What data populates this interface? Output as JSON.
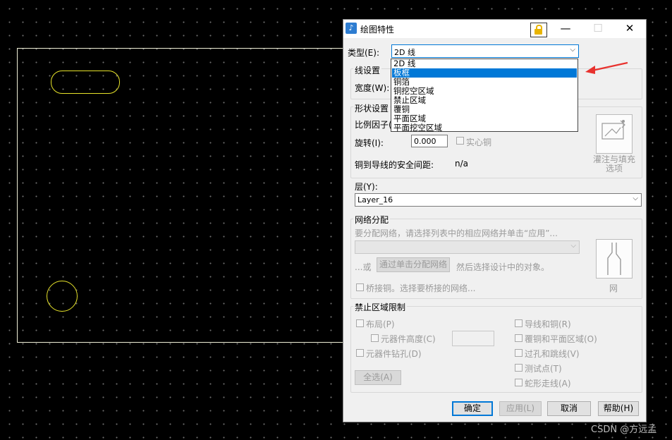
{
  "dialog": {
    "title": "绘图特性",
    "close_glyph": "✕",
    "minimize_glyph": "—",
    "maximize_glyph": "☐"
  },
  "type": {
    "label": "类型(E):",
    "value": "2D 线",
    "options": [
      "2D 线",
      "板框",
      "铜箔",
      "铜挖空区域",
      "禁止区域",
      "覆铜",
      "平面区域",
      "平面挖空区域"
    ],
    "selected_highlight": "板框"
  },
  "line_settings": {
    "group_label": "线设置",
    "width_label": "宽度(W):"
  },
  "shape_settings": {
    "group_label": "形状设置",
    "scale_label": "比例因子(",
    "rotate_label": "旋转(I):",
    "rotate_value": "0.000",
    "solid_copper_label": "实心铜",
    "clearance_label": "铜到导线的安全间距:",
    "clearance_value": "n/a",
    "flood_fill_label_line1": "灌注与填充",
    "flood_fill_label_line2": "选项"
  },
  "layer": {
    "label": "层(Y):",
    "value": "Layer_16"
  },
  "net": {
    "group_label": "网络分配",
    "hint": "要分配网络，请选择列表中的相应网络并单击“应用”...",
    "or_label": "...或",
    "assign_button": "通过单击分配网络",
    "then_label": "然后选择设计中的对象。",
    "bridge_label": "桥接铜。选择要桥接的网络...",
    "net_button_label": "网"
  },
  "keepout": {
    "group_label": "禁止区域限制",
    "placement": "布局(P)",
    "component_height": "元器件高度(C)",
    "component_drill": "元器件钻孔(D)",
    "select_all": "全选(A)",
    "traces_copper": "导线和铜(R)",
    "copper_pour_plane": "覆铜和平面区域(O)",
    "vias_jumpers": "过孔和跳线(V)",
    "test_points": "测试点(T)",
    "serpentine": "蛇形走线(A)"
  },
  "buttons": {
    "ok": "确定",
    "apply": "应用(L)",
    "cancel": "取消",
    "help": "帮助(H)"
  },
  "watermark": "CSDN @方远孟",
  "colors": {
    "board_outline": "#f0f0d8",
    "shape_outline": "#e8e42a",
    "highlight": "#0078d7",
    "arrow": "#e8322e"
  }
}
